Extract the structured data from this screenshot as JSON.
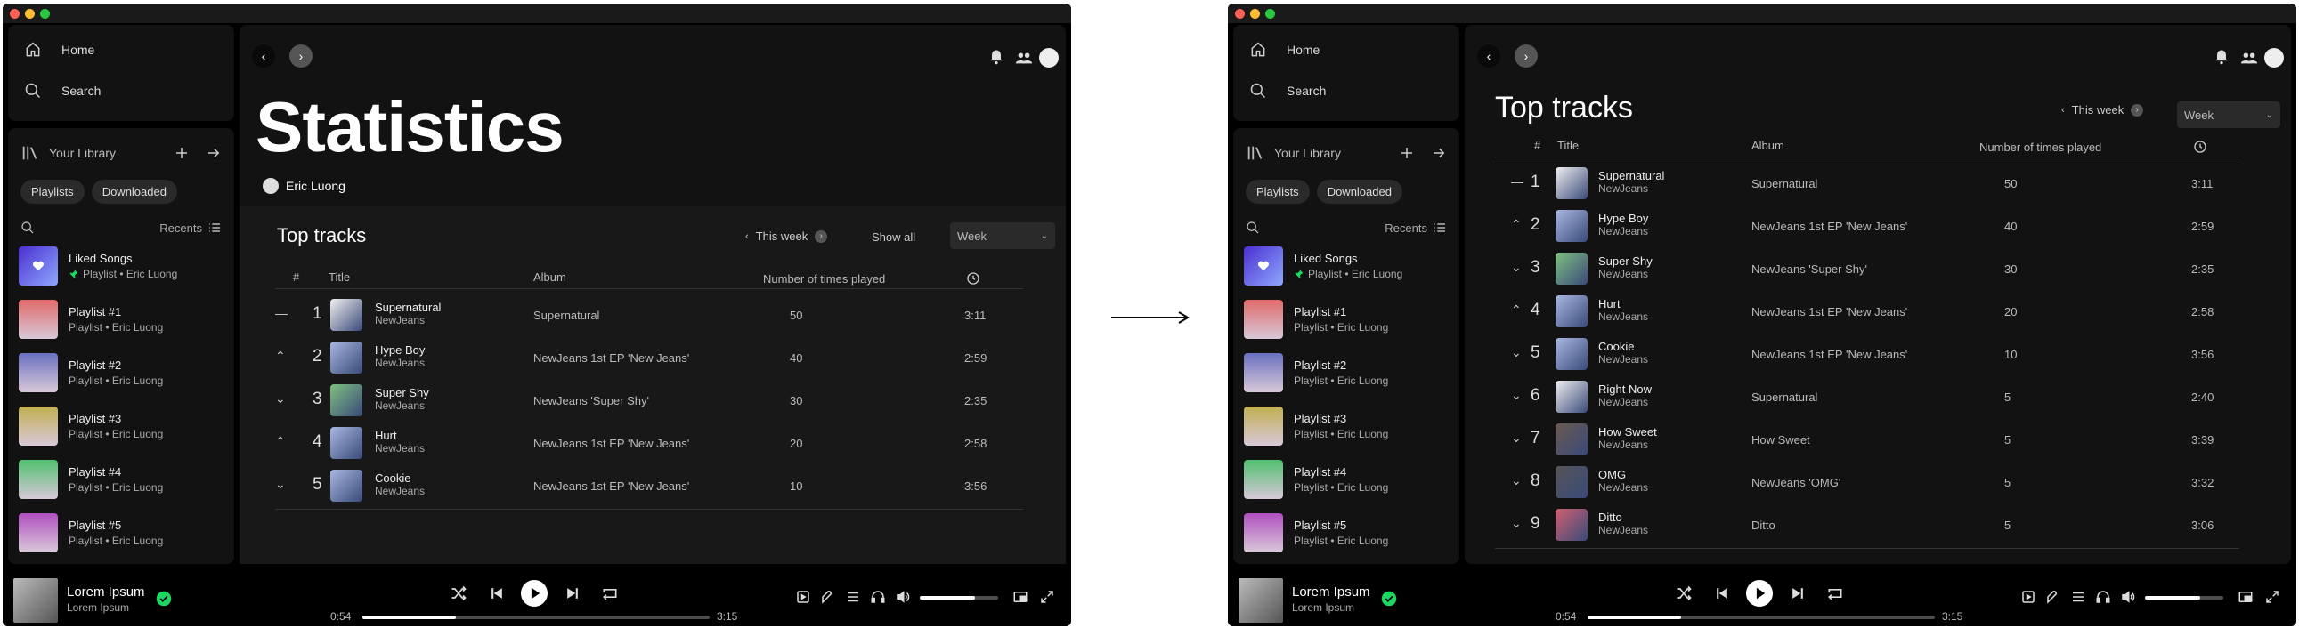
{
  "arrow": "→",
  "colors": {
    "accent": "#1ed760",
    "bg": "#121212",
    "window": "#000000",
    "traffic": [
      "#ff5f57",
      "#febc2e",
      "#28c840"
    ]
  },
  "nav": {
    "home": "Home",
    "search": "Search"
  },
  "library": {
    "title": "Your Library",
    "chips": [
      "Playlists",
      "Downloaded"
    ],
    "sort": "Recents",
    "items": [
      {
        "title": "Liked Songs",
        "subtitle": "Playlist • Eric Luong",
        "pinned": true,
        "color": "#5b3fe0"
      },
      {
        "title": "Playlist #1",
        "subtitle": "Playlist • Eric Luong",
        "color": "#e06a6a"
      },
      {
        "title": "Playlist #2",
        "subtitle": "Playlist • Eric Luong",
        "color": "#6a70c0"
      },
      {
        "title": "Playlist #3",
        "subtitle": "Playlist • Eric Luong",
        "color": "#c0b050"
      },
      {
        "title": "Playlist #4",
        "subtitle": "Playlist • Eric Luong",
        "color": "#50c070"
      },
      {
        "title": "Playlist #5",
        "subtitle": "Playlist • Eric Luong",
        "color": "#b050c0"
      }
    ]
  },
  "left": {
    "heading": "Statistics",
    "user": "Eric Luong",
    "section": "Top tracks",
    "range": "This week",
    "show_all": "Show all",
    "select": "Week"
  },
  "right": {
    "section": "Top tracks",
    "range": "This week",
    "select": "Week"
  },
  "table": {
    "headers": {
      "num": "#",
      "title": "Title",
      "album": "Album",
      "plays": "Number of times played"
    }
  },
  "tracks": [
    {
      "rank": "1",
      "trend": "—",
      "title": "Supernatural",
      "artist": "NewJeans",
      "album": "Supernatural",
      "plays": "50",
      "dur": "3:11",
      "art": "#f0f0f0"
    },
    {
      "rank": "2",
      "trend": "⌃",
      "title": "Hype Boy",
      "artist": "NewJeans",
      "album": "NewJeans 1st EP 'New Jeans'",
      "plays": "40",
      "dur": "2:59",
      "art": "#a8b8e0"
    },
    {
      "rank": "3",
      "trend": "⌄",
      "title": "Super Shy",
      "artist": "NewJeans",
      "album": "NewJeans 'Super Shy'",
      "plays": "30",
      "dur": "2:35",
      "art": "#7fc080"
    },
    {
      "rank": "4",
      "trend": "⌃",
      "title": "Hurt",
      "artist": "NewJeans",
      "album": "NewJeans 1st EP 'New Jeans'",
      "plays": "20",
      "dur": "2:58",
      "art": "#a8b8e0"
    },
    {
      "rank": "5",
      "trend": "⌄",
      "title": "Cookie",
      "artist": "NewJeans",
      "album": "NewJeans 1st EP 'New Jeans'",
      "plays": "10",
      "dur": "3:56",
      "art": "#a8b8e0"
    },
    {
      "rank": "6",
      "trend": "⌄",
      "title": "Right Now",
      "artist": "NewJeans",
      "album": "Supernatural",
      "plays": "5",
      "dur": "2:40",
      "art": "#f0f0f0"
    },
    {
      "rank": "7",
      "trend": "⌄",
      "title": "How Sweet",
      "artist": "NewJeans",
      "album": "How Sweet",
      "plays": "5",
      "dur": "3:39",
      "art": "#6a5a50"
    },
    {
      "rank": "8",
      "trend": "⌄",
      "title": "OMG",
      "artist": "NewJeans",
      "album": "NewJeans 'OMG'",
      "plays": "5",
      "dur": "3:32",
      "art": "#555555"
    },
    {
      "rank": "9",
      "trend": "⌄",
      "title": "Ditto",
      "artist": "NewJeans",
      "album": "Ditto",
      "plays": "5",
      "dur": "3:06",
      "art": "#d06070"
    }
  ],
  "player": {
    "title": "Lorem Ipsum",
    "artist": "Lorem Ipsum",
    "elapsed": "0:54",
    "total": "3:15",
    "progress": 0.27,
    "volume": 0.7
  }
}
